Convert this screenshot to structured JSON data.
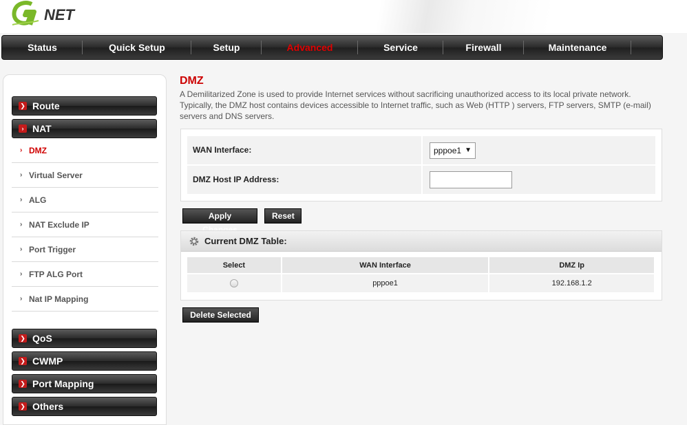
{
  "brand": {
    "logo_text": "NET",
    "accent": "#7ab829"
  },
  "topnav": {
    "items": [
      {
        "label": "Status"
      },
      {
        "label": "Quick Setup"
      },
      {
        "label": "Setup"
      },
      {
        "label": "Advanced"
      },
      {
        "label": "Service"
      },
      {
        "label": "Firewall"
      },
      {
        "label": "Maintenance"
      }
    ],
    "active": "Advanced"
  },
  "sidebar": {
    "route": "Route",
    "nat": "NAT",
    "nat_items": [
      "DMZ",
      "Virtual Server",
      "ALG",
      "NAT Exclude IP",
      "Port Trigger",
      "FTP ALG Port",
      "Nat IP Mapping"
    ],
    "active_item": "DMZ",
    "qos": "QoS",
    "cwmp": "CWMP",
    "port_mapping": "Port Mapping",
    "others": "Others"
  },
  "main": {
    "title": "DMZ",
    "description": "A Demilitarized Zone is used to provide Internet services without sacrificing unauthorized access to its local private network. Typically, the DMZ host contains devices accessible to Internet traffic, such as Web (HTTP ) servers, FTP servers, SMTP (e-mail) servers and DNS servers.",
    "wan_label": "WAN Interface:",
    "wan_value": "pppoe1",
    "host_label": "DMZ Host IP Address:",
    "host_value": "",
    "apply_button": "Apply Changes",
    "reset_button": "Reset",
    "table_title": "Current DMZ Table:",
    "table_headers": [
      "Select",
      "WAN Interface",
      "DMZ Ip"
    ],
    "table_rows": [
      {
        "wan": "pppoe1",
        "ip": "192.168.1.2"
      }
    ],
    "delete_button": "Delete Selected"
  }
}
